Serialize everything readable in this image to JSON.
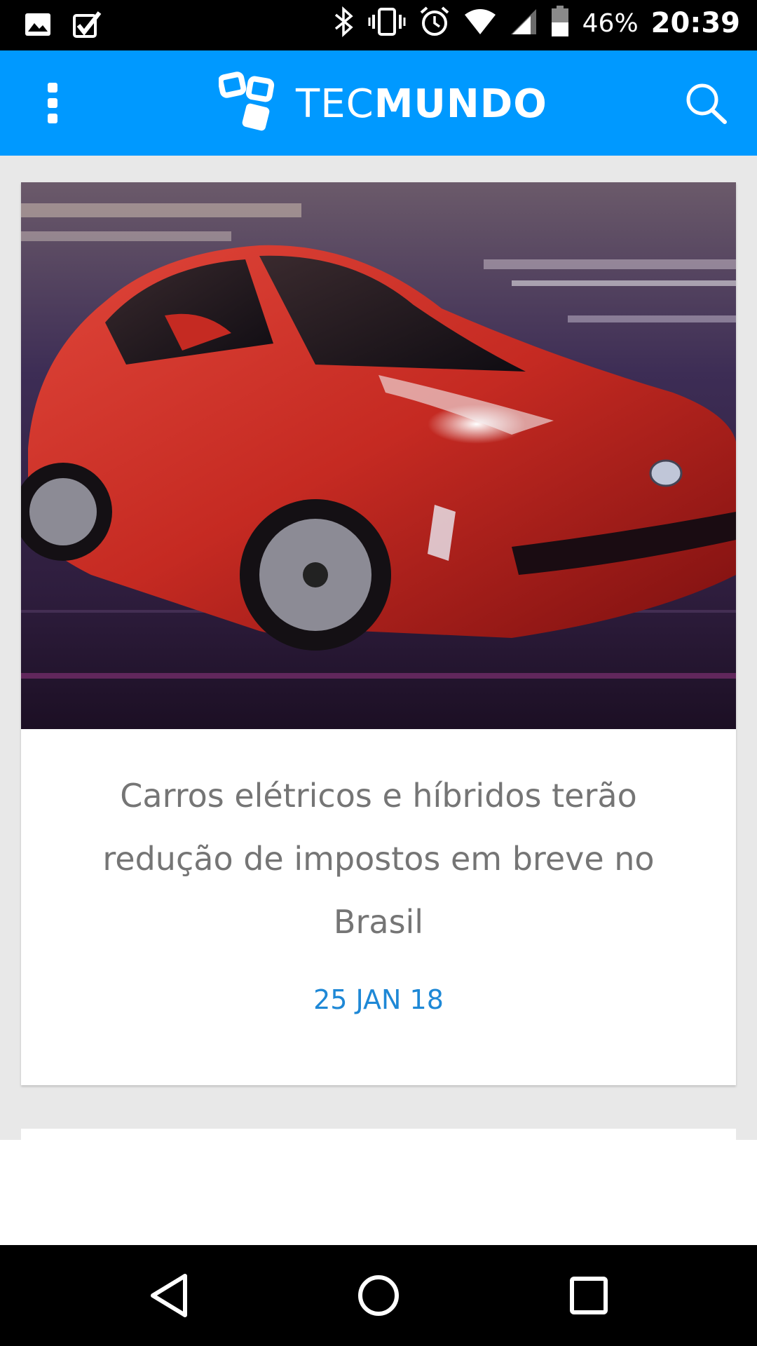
{
  "status_bar": {
    "icons": [
      "gallery-icon",
      "task-check-icon",
      "bluetooth-icon",
      "vibrate-icon",
      "alarm-icon",
      "wifi-icon",
      "signal-icon",
      "battery-icon"
    ],
    "battery_percent": "46%",
    "time": "20:39"
  },
  "app_bar": {
    "logo_light": "TEC",
    "logo_bold": "MUNDO",
    "brand_color": "#0099ff"
  },
  "article": {
    "title": "Carros elétricos e híbridos terão redução de impostos em breve no Brasil",
    "date": "25 JAN 18",
    "image": "red-car-photo"
  },
  "nav_bar": {
    "icons": [
      "back-icon",
      "home-icon",
      "recents-icon"
    ]
  }
}
